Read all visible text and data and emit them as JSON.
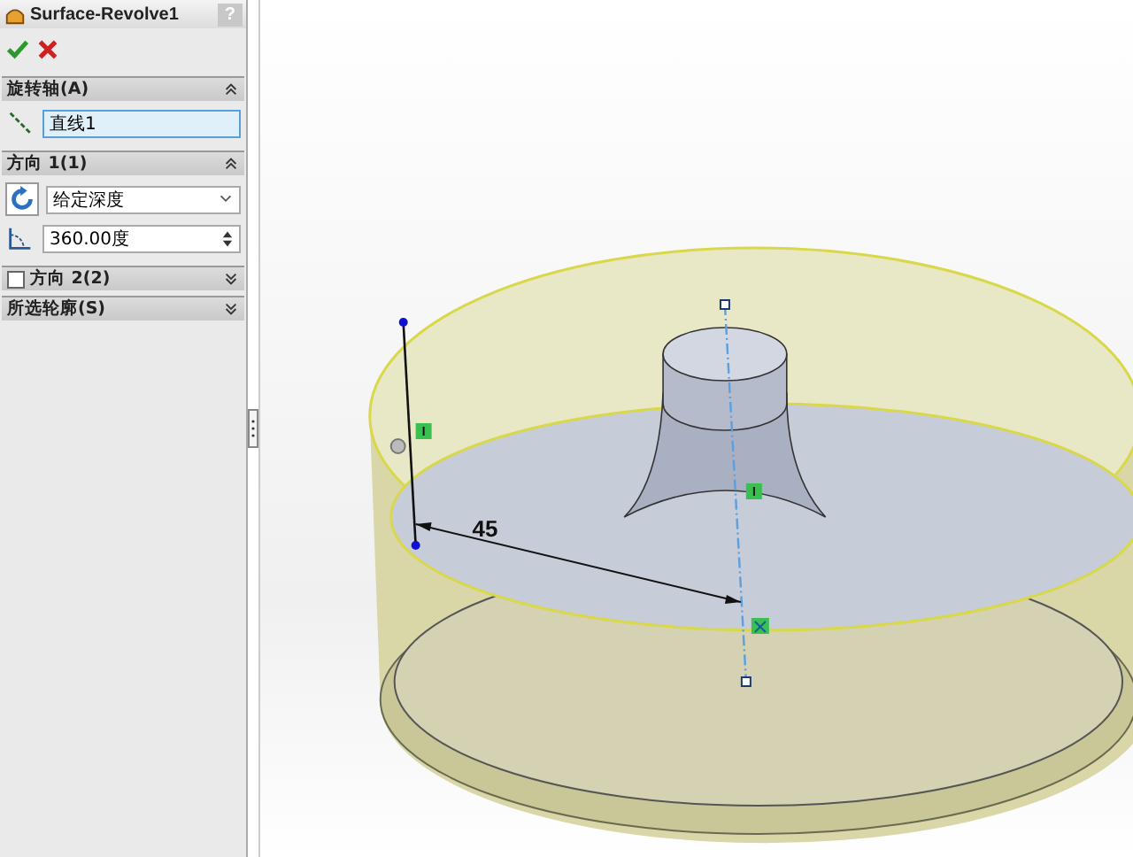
{
  "panel": {
    "title": "Surface-Revolve1",
    "help": "?"
  },
  "sections": [
    {
      "kind": "axis",
      "title": "旋转轴(A)",
      "expanded": true,
      "value": "直线1"
    },
    {
      "kind": "direction",
      "title": "方向 1(1)",
      "expanded": true,
      "end_condition": "给定深度",
      "angle": "360.00度"
    },
    {
      "kind": "option",
      "title": "方向 2(2)",
      "expanded": false,
      "checked": false
    },
    {
      "kind": "plain",
      "title": "所选轮廓(S)",
      "expanded": false
    }
  ],
  "canvas": {
    "dimension": "45"
  }
}
